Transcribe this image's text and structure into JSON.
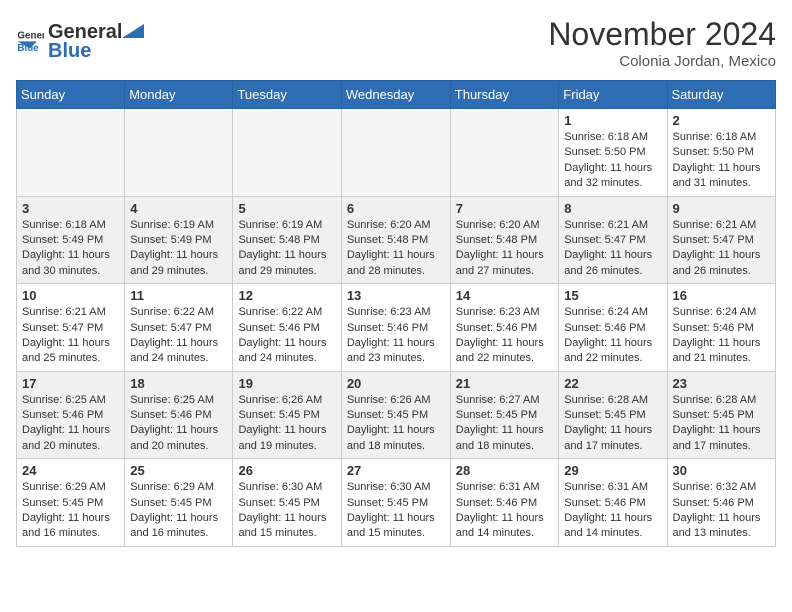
{
  "header": {
    "logo_general": "General",
    "logo_blue": "Blue",
    "month_title": "November 2024",
    "location": "Colonia Jordan, Mexico"
  },
  "weekdays": [
    "Sunday",
    "Monday",
    "Tuesday",
    "Wednesday",
    "Thursday",
    "Friday",
    "Saturday"
  ],
  "weeks": [
    {
      "shaded": false,
      "days": [
        {
          "date": "",
          "info": ""
        },
        {
          "date": "",
          "info": ""
        },
        {
          "date": "",
          "info": ""
        },
        {
          "date": "",
          "info": ""
        },
        {
          "date": "",
          "info": ""
        },
        {
          "date": "1",
          "info": "Sunrise: 6:18 AM\nSunset: 5:50 PM\nDaylight: 11 hours\nand 32 minutes."
        },
        {
          "date": "2",
          "info": "Sunrise: 6:18 AM\nSunset: 5:50 PM\nDaylight: 11 hours\nand 31 minutes."
        }
      ]
    },
    {
      "shaded": true,
      "days": [
        {
          "date": "3",
          "info": "Sunrise: 6:18 AM\nSunset: 5:49 PM\nDaylight: 11 hours\nand 30 minutes."
        },
        {
          "date": "4",
          "info": "Sunrise: 6:19 AM\nSunset: 5:49 PM\nDaylight: 11 hours\nand 29 minutes."
        },
        {
          "date": "5",
          "info": "Sunrise: 6:19 AM\nSunset: 5:48 PM\nDaylight: 11 hours\nand 29 minutes."
        },
        {
          "date": "6",
          "info": "Sunrise: 6:20 AM\nSunset: 5:48 PM\nDaylight: 11 hours\nand 28 minutes."
        },
        {
          "date": "7",
          "info": "Sunrise: 6:20 AM\nSunset: 5:48 PM\nDaylight: 11 hours\nand 27 minutes."
        },
        {
          "date": "8",
          "info": "Sunrise: 6:21 AM\nSunset: 5:47 PM\nDaylight: 11 hours\nand 26 minutes."
        },
        {
          "date": "9",
          "info": "Sunrise: 6:21 AM\nSunset: 5:47 PM\nDaylight: 11 hours\nand 26 minutes."
        }
      ]
    },
    {
      "shaded": false,
      "days": [
        {
          "date": "10",
          "info": "Sunrise: 6:21 AM\nSunset: 5:47 PM\nDaylight: 11 hours\nand 25 minutes."
        },
        {
          "date": "11",
          "info": "Sunrise: 6:22 AM\nSunset: 5:47 PM\nDaylight: 11 hours\nand 24 minutes."
        },
        {
          "date": "12",
          "info": "Sunrise: 6:22 AM\nSunset: 5:46 PM\nDaylight: 11 hours\nand 24 minutes."
        },
        {
          "date": "13",
          "info": "Sunrise: 6:23 AM\nSunset: 5:46 PM\nDaylight: 11 hours\nand 23 minutes."
        },
        {
          "date": "14",
          "info": "Sunrise: 6:23 AM\nSunset: 5:46 PM\nDaylight: 11 hours\nand 22 minutes."
        },
        {
          "date": "15",
          "info": "Sunrise: 6:24 AM\nSunset: 5:46 PM\nDaylight: 11 hours\nand 22 minutes."
        },
        {
          "date": "16",
          "info": "Sunrise: 6:24 AM\nSunset: 5:46 PM\nDaylight: 11 hours\nand 21 minutes."
        }
      ]
    },
    {
      "shaded": true,
      "days": [
        {
          "date": "17",
          "info": "Sunrise: 6:25 AM\nSunset: 5:46 PM\nDaylight: 11 hours\nand 20 minutes."
        },
        {
          "date": "18",
          "info": "Sunrise: 6:25 AM\nSunset: 5:46 PM\nDaylight: 11 hours\nand 20 minutes."
        },
        {
          "date": "19",
          "info": "Sunrise: 6:26 AM\nSunset: 5:45 PM\nDaylight: 11 hours\nand 19 minutes."
        },
        {
          "date": "20",
          "info": "Sunrise: 6:26 AM\nSunset: 5:45 PM\nDaylight: 11 hours\nand 18 minutes."
        },
        {
          "date": "21",
          "info": "Sunrise: 6:27 AM\nSunset: 5:45 PM\nDaylight: 11 hours\nand 18 minutes."
        },
        {
          "date": "22",
          "info": "Sunrise: 6:28 AM\nSunset: 5:45 PM\nDaylight: 11 hours\nand 17 minutes."
        },
        {
          "date": "23",
          "info": "Sunrise: 6:28 AM\nSunset: 5:45 PM\nDaylight: 11 hours\nand 17 minutes."
        }
      ]
    },
    {
      "shaded": false,
      "days": [
        {
          "date": "24",
          "info": "Sunrise: 6:29 AM\nSunset: 5:45 PM\nDaylight: 11 hours\nand 16 minutes."
        },
        {
          "date": "25",
          "info": "Sunrise: 6:29 AM\nSunset: 5:45 PM\nDaylight: 11 hours\nand 16 minutes."
        },
        {
          "date": "26",
          "info": "Sunrise: 6:30 AM\nSunset: 5:45 PM\nDaylight: 11 hours\nand 15 minutes."
        },
        {
          "date": "27",
          "info": "Sunrise: 6:30 AM\nSunset: 5:45 PM\nDaylight: 11 hours\nand 15 minutes."
        },
        {
          "date": "28",
          "info": "Sunrise: 6:31 AM\nSunset: 5:46 PM\nDaylight: 11 hours\nand 14 minutes."
        },
        {
          "date": "29",
          "info": "Sunrise: 6:31 AM\nSunset: 5:46 PM\nDaylight: 11 hours\nand 14 minutes."
        },
        {
          "date": "30",
          "info": "Sunrise: 6:32 AM\nSunset: 5:46 PM\nDaylight: 11 hours\nand 13 minutes."
        }
      ]
    }
  ]
}
